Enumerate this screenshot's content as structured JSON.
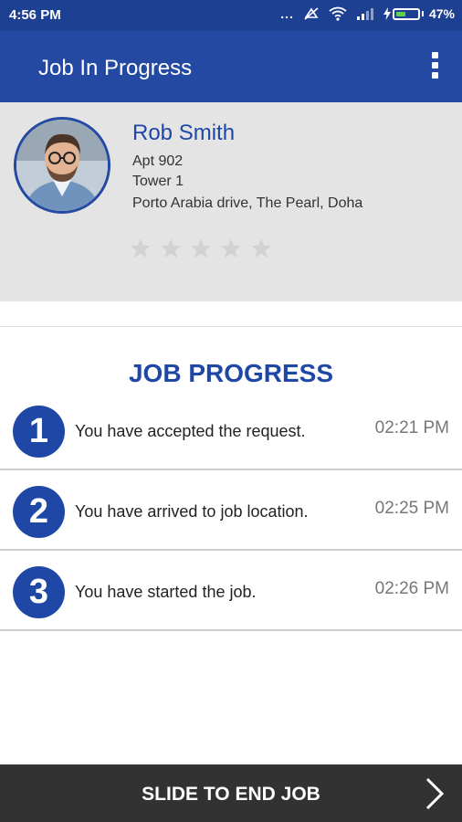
{
  "status_bar": {
    "time": "4:56 PM",
    "dots": "...",
    "battery_percent": "47%",
    "battery_level": 0.47
  },
  "app_bar": {
    "title": "Job In Progress",
    "menu_icon": "more-vert-icon"
  },
  "customer": {
    "name": "Rob Smith",
    "address_line1": "Apt 902",
    "address_line2": "Tower 1",
    "address_line3": "Porto Arabia drive, The Pearl, Doha",
    "rating": 0,
    "max_rating": 5
  },
  "progress": {
    "title": "JOB PROGRESS",
    "steps": [
      {
        "number": "1",
        "text": "You have accepted the request.",
        "time": "02:21 PM"
      },
      {
        "number": "2",
        "text": "You have arrived to job location.",
        "time": "02:25 PM"
      },
      {
        "number": "3",
        "text": "You have started the job.",
        "time": "02:26 PM"
      }
    ]
  },
  "slide": {
    "label": "SLIDE TO END JOB",
    "icon": "chevron-right-icon"
  },
  "colors": {
    "primary": "#2349a3",
    "status_bar": "#1e4092",
    "accent_text": "#1f47a5",
    "header_bg": "#e4e4e4",
    "slide_bar": "#323232",
    "battery": "#5ed04a"
  }
}
